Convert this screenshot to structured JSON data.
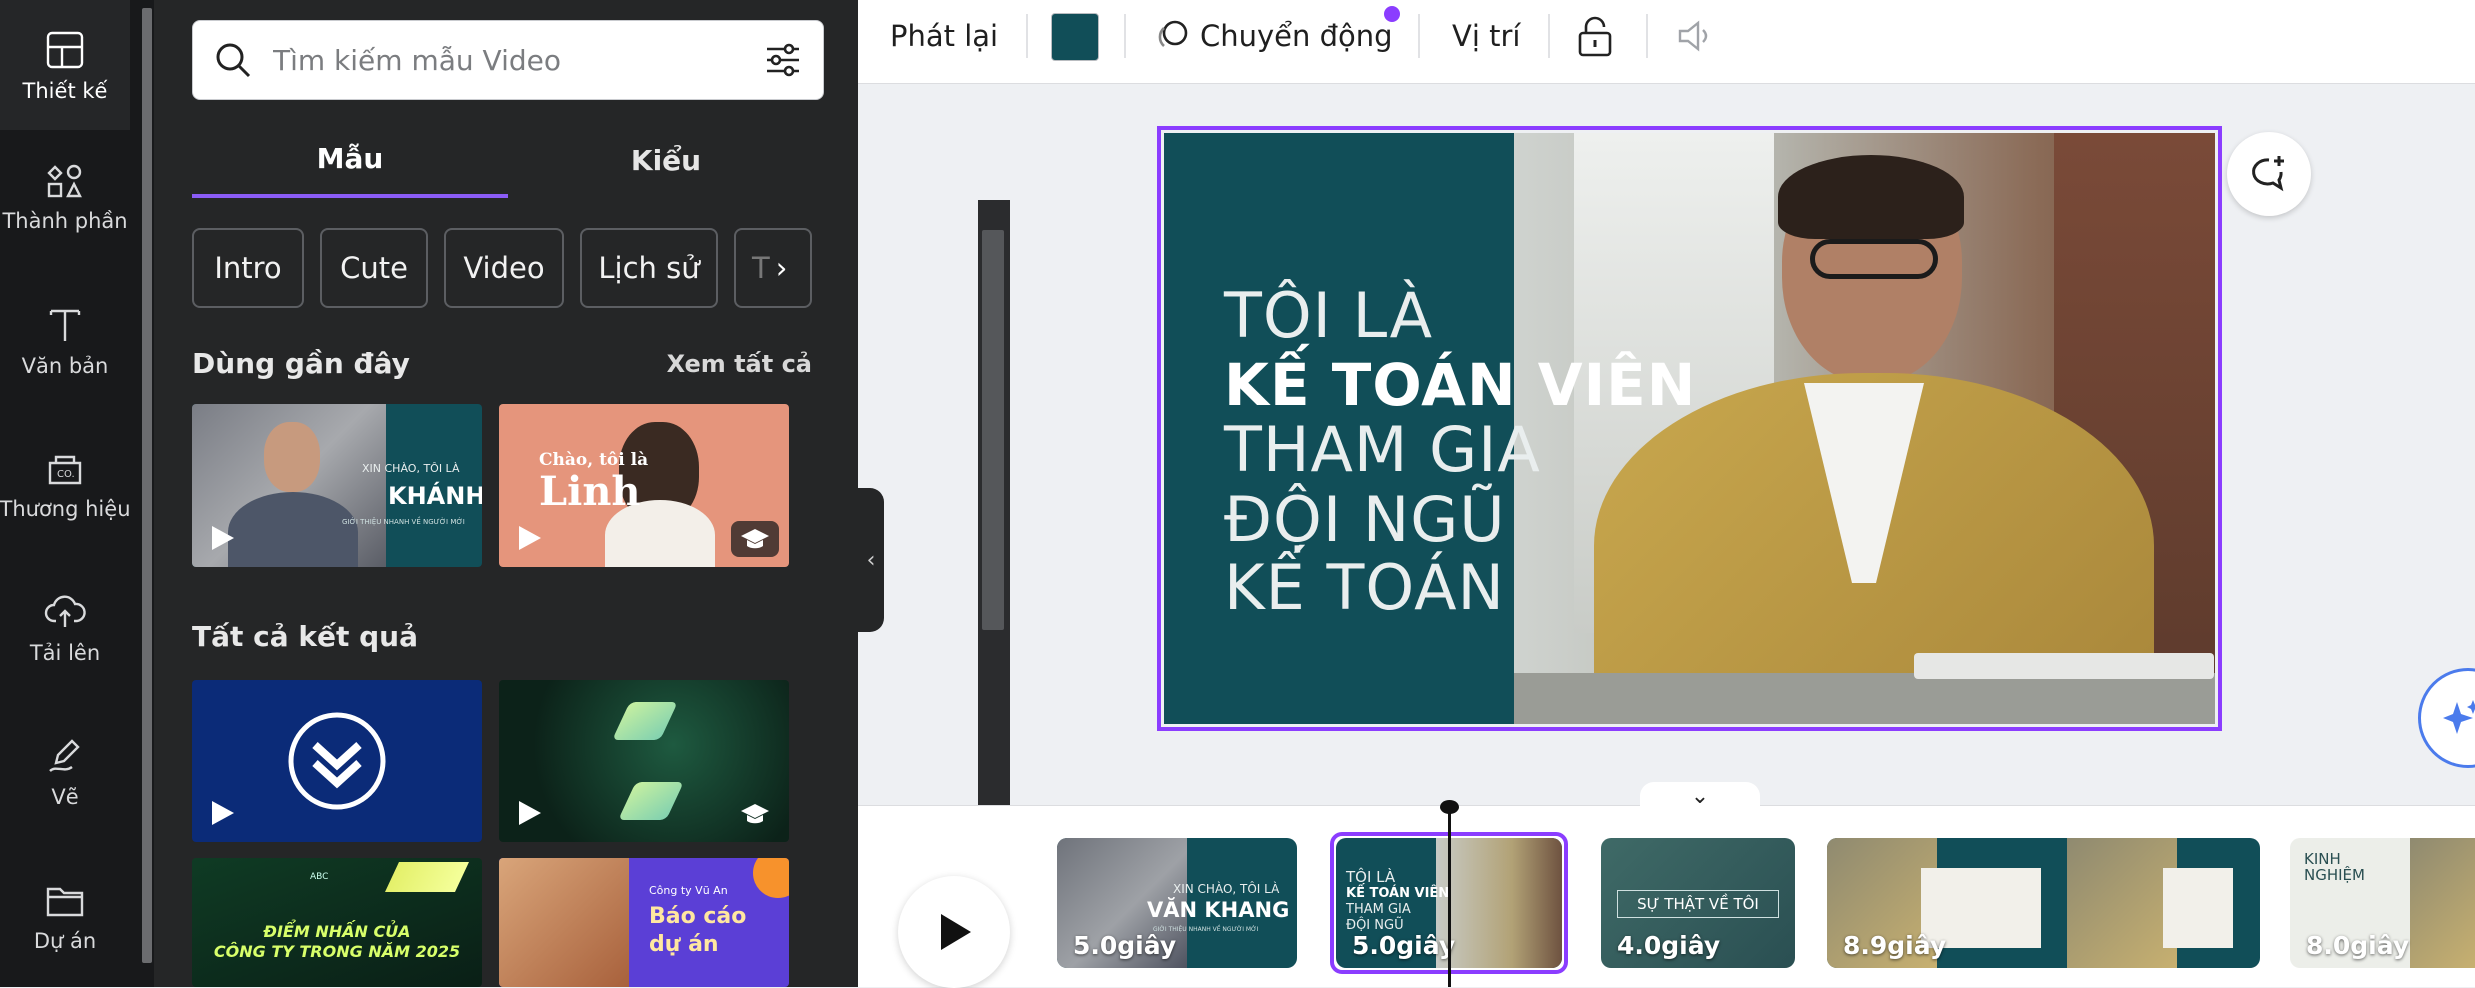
{
  "rail": {
    "items": [
      {
        "label": "Thiết kế",
        "icon": "layout-icon"
      },
      {
        "label": "Thành phần",
        "icon": "elements-icon"
      },
      {
        "label": "Văn bản",
        "icon": "text-icon"
      },
      {
        "label": "Thương hiệu",
        "icon": "brand-icon"
      },
      {
        "label": "Tải lên",
        "icon": "upload-cloud-icon"
      },
      {
        "label": "Vẽ",
        "icon": "draw-icon"
      },
      {
        "label": "Dự án",
        "icon": "folder-icon"
      }
    ]
  },
  "panel": {
    "search_placeholder": "Tìm kiếm mẫu Video",
    "tabs": [
      "Mẫu",
      "Kiểu"
    ],
    "chips": [
      "Intro",
      "Cute",
      "Video",
      "Lịch sử",
      "T"
    ],
    "recent_title": "Dùng gần đây",
    "see_all": "Xem tất cả",
    "results_title": "Tất cả kết quả",
    "recent": [
      {
        "line1": "XIN CHÀO, TÔI LÀ",
        "line2": "KHÁNH",
        "line3": "GIỚI THIỆU NHANH VỀ NGƯỜI MỚI"
      },
      {
        "line1": "Chào, tôi là",
        "line2": "Linh"
      }
    ],
    "results": [
      {
        "caption_line1": "ĐIỂM NHẤN CỦA",
        "caption_line2": "CÔNG TY TRONG NĂM 2025",
        "brand": "ABC"
      },
      {
        "company": "Công ty Vũ An",
        "title_line1": "Báo cáo",
        "title_line2": "dự án"
      }
    ]
  },
  "toolbar": {
    "playback": "Phát lại",
    "swatch_color": "#114e58",
    "motion": "Chuyển động",
    "position": "Vị trí"
  },
  "slide": {
    "line1": "TÔI LÀ",
    "line2": "KẾ TOÁN VIÊN",
    "line3": "THAM GIA",
    "line4": "ĐỘI NGŨ",
    "line5": "KẾ TOÁN",
    "accent": "#114e58"
  },
  "timeline": {
    "clips": [
      {
        "duration": "5.0giây",
        "text1": "XIN CHÀO, TÔI LÀ",
        "text2": "VĂN KHANG",
        "text3": "GIỚI THIỆU NHANH VỀ NGƯỜI MỚI"
      },
      {
        "duration": "5.0giây",
        "text1": "TÔI LÀ",
        "text2": "KẾ TOÁN VIÊN",
        "text3": "THAM GIA",
        "text4": "ĐỘI NGŨ"
      },
      {
        "duration": "4.0giây",
        "text1": "SỰ THẬT VỀ TÔI"
      },
      {
        "duration": "8.9giây"
      },
      {
        "duration": "8.0giây",
        "text1": "KINH",
        "text2": "NGHIỆM"
      }
    ]
  },
  "colors": {
    "accent_purple": "#8b3dff",
    "teal": "#114e58",
    "rail_bg": "#18191b",
    "panel_bg": "#252627"
  }
}
